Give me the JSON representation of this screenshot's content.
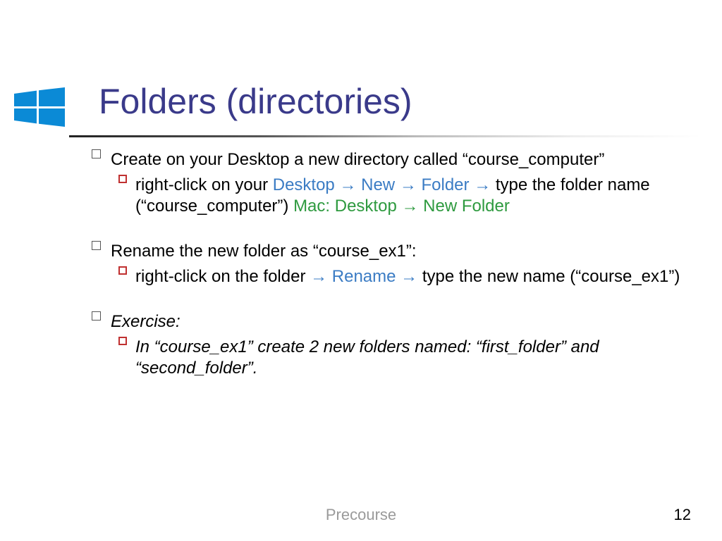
{
  "title": "Folders (directories)",
  "footer": {
    "center": "Precourse",
    "page": "12"
  },
  "body": {
    "items": [
      {
        "text": "Create on your Desktop a new directory called “course_computer”",
        "sub": [
          {
            "prefix": "right-click on your ",
            "seq_blue": {
              "a": "Desktop",
              "b": "New",
              "c": "Folder"
            },
            "mid": " type the folder name (“course_computer”) ",
            "mac_label": "Mac: ",
            "mac_a": "Desktop",
            "mac_b": "New Folder"
          }
        ]
      },
      {
        "text": "Rename the new folder as “course_ex1”:",
        "sub": [
          {
            "prefix": "right-click on the folder ",
            "rename": "Rename",
            "suffix": " type the new name (“course_ex1”)"
          }
        ]
      },
      {
        "text": "Exercise:",
        "italic": true,
        "sub": [
          {
            "plain": "In “course_ex1” create 2 new folders named: “first_folder” and “second_folder”.",
            "italic": true
          }
        ]
      }
    ]
  },
  "arrows": {
    "right": "→"
  }
}
